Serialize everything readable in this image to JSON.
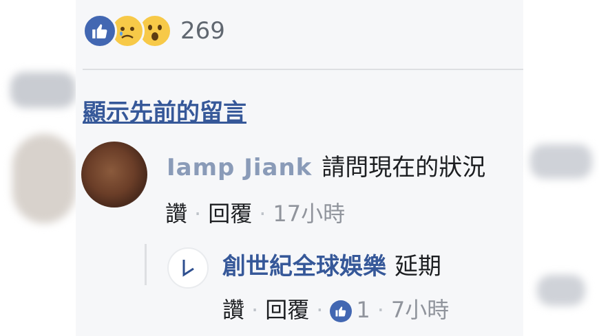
{
  "post": {
    "reaction_count": "269",
    "reactions": [
      "like-icon",
      "sad-icon",
      "wow-icon"
    ]
  },
  "view_previous_comments": "顯示先前的留言",
  "comments": [
    {
      "author": "Iamp Jiank",
      "text": "請問現在的狀況",
      "actions": {
        "like": "讚",
        "reply": "回覆",
        "time": "17小時"
      }
    }
  ],
  "replies": [
    {
      "author": "創世紀全球娛樂",
      "text": "延期",
      "actions": {
        "like": "讚",
        "reply": "回覆",
        "like_count": "1",
        "time": "7小時"
      }
    }
  ],
  "colors": {
    "link": "#365899",
    "like_blue": "#4267b2",
    "meta_gray": "#90949c",
    "panel_bg": "#f6f7f9"
  }
}
